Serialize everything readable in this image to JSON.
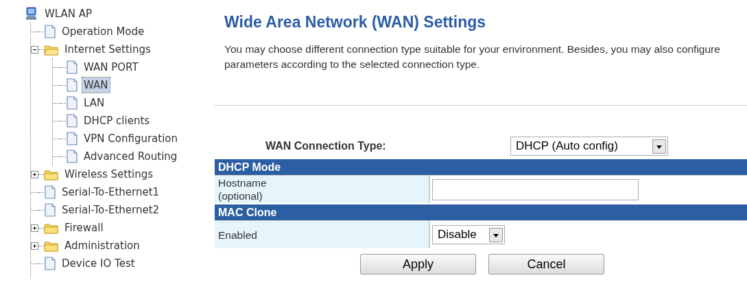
{
  "tree": {
    "label": "WLAN AP",
    "children": [
      {
        "label": "Operation Mode",
        "kind": "page",
        "selected": false
      },
      {
        "label": "Internet Settings",
        "kind": "folder",
        "expanded": true,
        "children": [
          {
            "label": "WAN PORT",
            "kind": "page",
            "selected": false
          },
          {
            "label": "WAN",
            "kind": "page",
            "selected": true
          },
          {
            "label": "LAN",
            "kind": "page",
            "selected": false
          },
          {
            "label": "DHCP clients",
            "kind": "page",
            "selected": false
          },
          {
            "label": "VPN Configuration",
            "kind": "page",
            "selected": false
          },
          {
            "label": "Advanced Routing",
            "kind": "page",
            "selected": false
          }
        ]
      },
      {
        "label": "Wireless Settings",
        "kind": "folder",
        "expanded": false
      },
      {
        "label": "Serial-To-Ethernet1",
        "kind": "page",
        "selected": false
      },
      {
        "label": "Serial-To-Ethernet2",
        "kind": "page",
        "selected": false
      },
      {
        "label": "Firewall",
        "kind": "folder",
        "expanded": false
      },
      {
        "label": "Administration",
        "kind": "folder",
        "expanded": false
      },
      {
        "label": "Device IO Test",
        "kind": "page",
        "selected": false
      }
    ]
  },
  "page": {
    "title": "Wide Area Network (WAN) Settings",
    "description": "You may choose different connection type suitable for your environment. Besides, you may also configure parameters according to the selected connection type."
  },
  "connection_type": {
    "label": "WAN Connection Type:",
    "value": "DHCP (Auto config)"
  },
  "sections": [
    {
      "title": "DHCP Mode",
      "rows": [
        {
          "kind": "text",
          "label": "Hostname\n(optional)",
          "value": ""
        }
      ]
    },
    {
      "title": "MAC Clone",
      "rows": [
        {
          "kind": "select",
          "label": "Enabled",
          "value": "Disable"
        }
      ]
    }
  ],
  "buttons": [
    "Apply",
    "Cancel"
  ]
}
